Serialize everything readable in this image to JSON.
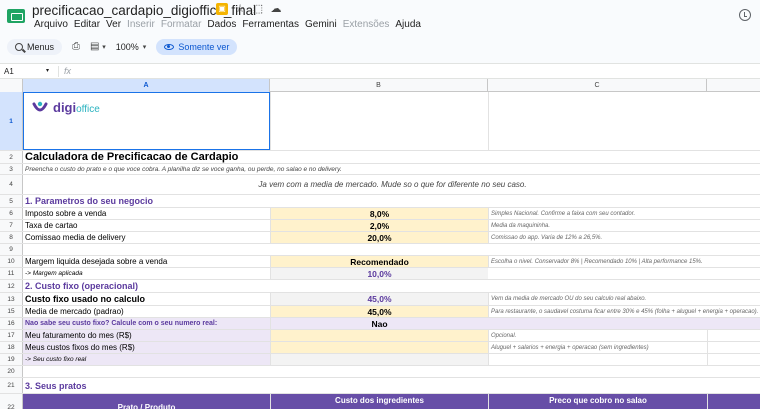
{
  "app": {
    "title": "precificacao_cardapio_digioffice_final",
    "menus": [
      "Arquivo",
      "Editar",
      "Ver",
      "Inserir",
      "Formatar",
      "Dados",
      "Ferramentas",
      "Gemini",
      "Extensões",
      "Ajuda"
    ],
    "disabled_menus": [
      "Inserir",
      "Formatar",
      "Extensões"
    ]
  },
  "toolbar": {
    "menus_label": "Menus",
    "zoom": "100%",
    "view_mode": "Somente ver"
  },
  "formula_bar": {
    "cell_ref": "A1",
    "fx": "fx",
    "content": ""
  },
  "columns": [
    "A",
    "B",
    "C"
  ],
  "sheet": {
    "logo": {
      "brand": "digi",
      "suffix": "office"
    },
    "r2": {
      "num": "2",
      "a": "Calculadora de Precificacao de Cardapio"
    },
    "r3": {
      "num": "3",
      "a": "Preencha o custo do prato e o que voce cobra. A planilha diz se voce ganha, ou perde, no salao e no delivery."
    },
    "r4": {
      "num": "4",
      "a": "Ja vem com a media de mercado. Mude so o que for diferente no seu caso."
    },
    "r5": {
      "num": "5",
      "a": "1. Parametros do seu negocio"
    },
    "r6": {
      "num": "6",
      "a": "Imposto sobre a venda",
      "b": "8,0%",
      "c": "Simples Nacional. Confirme a faixa com seu contador."
    },
    "r7": {
      "num": "7",
      "a": "Taxa de cartao",
      "b": "2,0%",
      "c": "Media da maquininha."
    },
    "r8": {
      "num": "8",
      "a": "Comissao media de delivery",
      "b": "20,0%",
      "c": "Comissao do app. Varia de 12% a 26,5%."
    },
    "r9": {
      "num": "9"
    },
    "r10": {
      "num": "10",
      "a": "Margem liquida desejada sobre a venda",
      "b": "Recomendado",
      "c": "Escolha o nivel. Conservador 8% | Recomendado 10% | Alta performance 15%."
    },
    "r11": {
      "num": "11",
      "a": "-> Margem aplicada",
      "b": "10,0%"
    },
    "r12": {
      "num": "12",
      "a": "2. Custo fixo (operacional)"
    },
    "r13": {
      "num": "13",
      "a": "Custo fixo usado no calculo",
      "b": "45,0%",
      "c": "Vem da media de mercado OU do seu calculo real abaixo."
    },
    "r14": {
      "num": "15",
      "a": "Media de mercado (padrao)",
      "b": "45,0%",
      "c": "Para restaurante, o saudavel costuma ficar entre 30% e 45% (folha + aluguel + energia + operacao)."
    },
    "r15": {
      "num": "16",
      "a": "Nao sabe seu custo fixo? Calcule com o seu numero real:",
      "b": "Nao"
    },
    "r16": {
      "num": "17",
      "a": "Meu faturamento do mes (R$)",
      "c": "Opcional."
    },
    "r17": {
      "num": "18",
      "a": "Meus custos fixos do mes (R$)",
      "c": "Aluguel + salarios + energia + operacao (sem ingredientes)"
    },
    "r18": {
      "num": "19",
      "a": "-> Seu custo fixo real"
    },
    "r19": {
      "num": "20"
    },
    "r20": {
      "num": "21",
      "a": "3. Seus pratos"
    },
    "r21": {
      "num": "22",
      "a": "Prato / Produto",
      "b": "Custo dos ingredientes",
      "c": "Preco que cobro no salao"
    }
  },
  "row1_num": "1",
  "row14_num": "14",
  "colors": {
    "accent_purple": "#5b3a9e",
    "header_purple": "#674ea7",
    "input_yellow": "#fff2cc",
    "lavender": "#ede7f6",
    "selection_blue": "#1a73e8"
  }
}
